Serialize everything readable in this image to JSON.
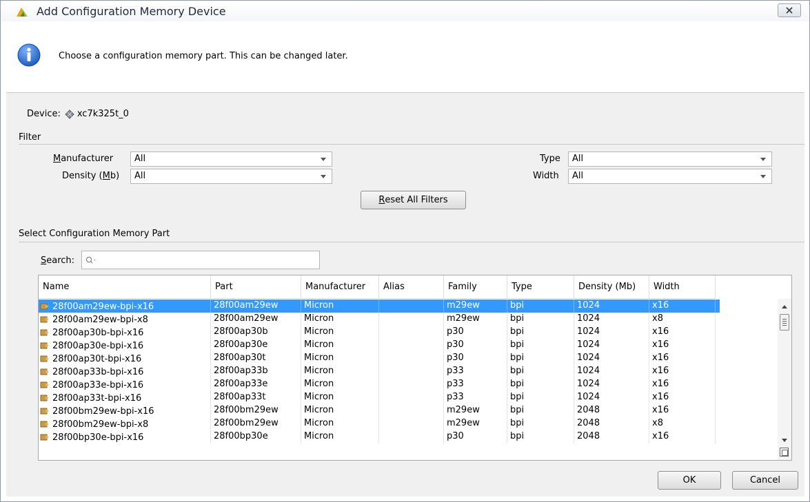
{
  "window": {
    "title": "Add Configuration Memory Device",
    "info_message": "Choose a configuration memory part. This can be changed later."
  },
  "device": {
    "label": "Device:",
    "value": "xc7k325t_0"
  },
  "filter": {
    "section_label": "Filter",
    "manufacturer": {
      "label_accel": "M",
      "label_rest": "anufacturer",
      "value": "All"
    },
    "density": {
      "label_pre": "Density (",
      "label_accel": "M",
      "label_post": "b)",
      "value": "All"
    },
    "type": {
      "label": "Type",
      "value": "All"
    },
    "width": {
      "label": "Width",
      "value": "All"
    },
    "reset_accel": "R",
    "reset_rest": "eset All Filters"
  },
  "select_section": {
    "label": "Select Configuration Memory Part",
    "search_accel": "S",
    "search_rest": "earch:",
    "search_value": ""
  },
  "table": {
    "columns": [
      "Name",
      "Part",
      "Manufacturer",
      "Alias",
      "Family",
      "Type",
      "Density (Mb)",
      "Width"
    ],
    "rows": [
      [
        "28f00am29ew-bpi-x16",
        "28f00am29ew",
        "Micron",
        "",
        "m29ew",
        "bpi",
        "1024",
        "x16"
      ],
      [
        "28f00am29ew-bpi-x8",
        "28f00am29ew",
        "Micron",
        "",
        "m29ew",
        "bpi",
        "1024",
        "x8"
      ],
      [
        "28f00ap30b-bpi-x16",
        "28f00ap30b",
        "Micron",
        "",
        "p30",
        "bpi",
        "1024",
        "x16"
      ],
      [
        "28f00ap30e-bpi-x16",
        "28f00ap30e",
        "Micron",
        "",
        "p30",
        "bpi",
        "1024",
        "x16"
      ],
      [
        "28f00ap30t-bpi-x16",
        "28f00ap30t",
        "Micron",
        "",
        "p30",
        "bpi",
        "1024",
        "x16"
      ],
      [
        "28f00ap33b-bpi-x16",
        "28f00ap33b",
        "Micron",
        "",
        "p33",
        "bpi",
        "1024",
        "x16"
      ],
      [
        "28f00ap33e-bpi-x16",
        "28f00ap33e",
        "Micron",
        "",
        "p33",
        "bpi",
        "1024",
        "x16"
      ],
      [
        "28f00ap33t-bpi-x16",
        "28f00ap33t",
        "Micron",
        "",
        "p33",
        "bpi",
        "1024",
        "x16"
      ],
      [
        "28f00bm29ew-bpi-x16",
        "28f00bm29ew",
        "Micron",
        "",
        "m29ew",
        "bpi",
        "2048",
        "x16"
      ],
      [
        "28f00bm29ew-bpi-x8",
        "28f00bm29ew",
        "Micron",
        "",
        "m29ew",
        "bpi",
        "2048",
        "x8"
      ],
      [
        "28f00bp30e-bpi-x16",
        "28f00bp30e",
        "Micron",
        "",
        "p30",
        "bpi",
        "2048",
        "x16"
      ]
    ],
    "selected_row": 0
  },
  "buttons": {
    "ok": "OK",
    "cancel": "Cancel"
  },
  "colors": {
    "selection": "#3399ff",
    "body_bg": "#f0f0f0",
    "info_blue": "#1f5fbf"
  },
  "icons": {
    "app": "vivado-logo-icon",
    "close": "close-icon",
    "info": "info-icon",
    "device": "chip-icon",
    "part": "memory-part-icon",
    "search": "search-icon"
  }
}
